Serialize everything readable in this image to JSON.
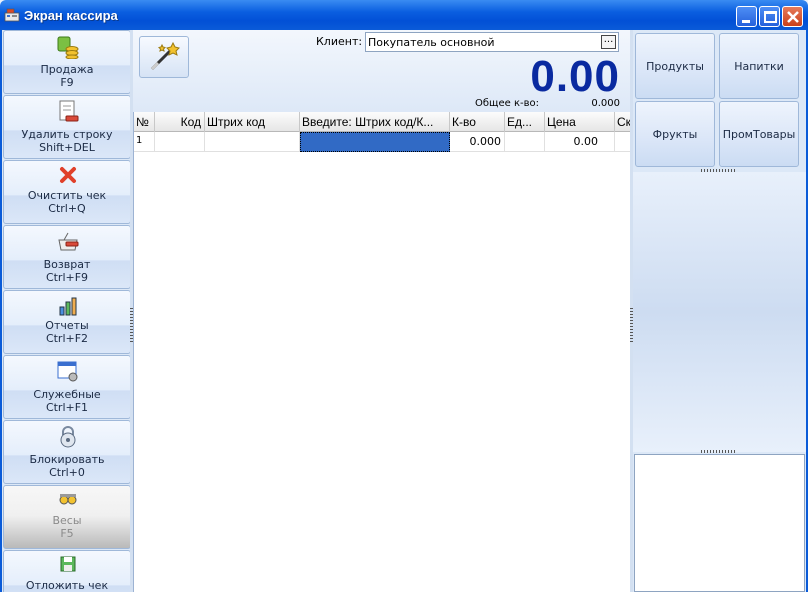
{
  "window": {
    "title": "Экран кассира",
    "controls": [
      "minimize-icon",
      "maximize-icon",
      "close-icon"
    ]
  },
  "sidebar": {
    "items": [
      {
        "label": "Продажа",
        "shortcut": "F9",
        "icon": "coins-icon",
        "enabled": true
      },
      {
        "label": "Удалить строку",
        "shortcut": "Shift+DEL",
        "icon": "delete-row-icon",
        "enabled": true
      },
      {
        "label": "Очистить чек",
        "shortcut": "Ctrl+Q",
        "icon": "clear-x-icon",
        "enabled": true
      },
      {
        "label": "Возврат",
        "shortcut": "Ctrl+F9",
        "icon": "return-basket-icon",
        "enabled": true
      },
      {
        "label": "Отчеты",
        "shortcut": "Ctrl+F2",
        "icon": "chart-icon",
        "enabled": true
      },
      {
        "label": "Служебные",
        "shortcut": "Ctrl+F1",
        "icon": "service-window-icon",
        "enabled": true
      },
      {
        "label": "Блокировать",
        "shortcut": "Ctrl+0",
        "icon": "padlock-icon",
        "enabled": true
      },
      {
        "label": "Весы",
        "shortcut": "F5",
        "icon": "scales-icon",
        "enabled": false
      },
      {
        "label": "Отложить чек",
        "shortcut": "",
        "icon": "save-disk-icon",
        "enabled": true
      }
    ]
  },
  "header": {
    "wand_icon": "magic-wand-icon",
    "client_label": "Клиент:",
    "client_value": "Покупатель основной",
    "client_browse": "...",
    "total": "0.00",
    "qty_label": "Общее к-во:",
    "qty_value": "0.000"
  },
  "table": {
    "columns": [
      "№",
      "Код",
      "Штрих код",
      "Введите: Штрих код/К...",
      "К-во",
      "Ед...",
      "Цена",
      "Ск"
    ],
    "rows": [
      {
        "num": "1",
        "code": "",
        "barcode": "",
        "input": "",
        "qty": "0.000",
        "unit": "",
        "price": "0.00",
        "disc": ""
      }
    ]
  },
  "categories": [
    "Продукты",
    "Напитки",
    "Фрукты",
    "ПромТовары"
  ],
  "colors": {
    "titlebar": "#0a5bd8",
    "total_text": "#0a2aa0",
    "selection": "#316ac5",
    "panel": "#dce8f7"
  }
}
